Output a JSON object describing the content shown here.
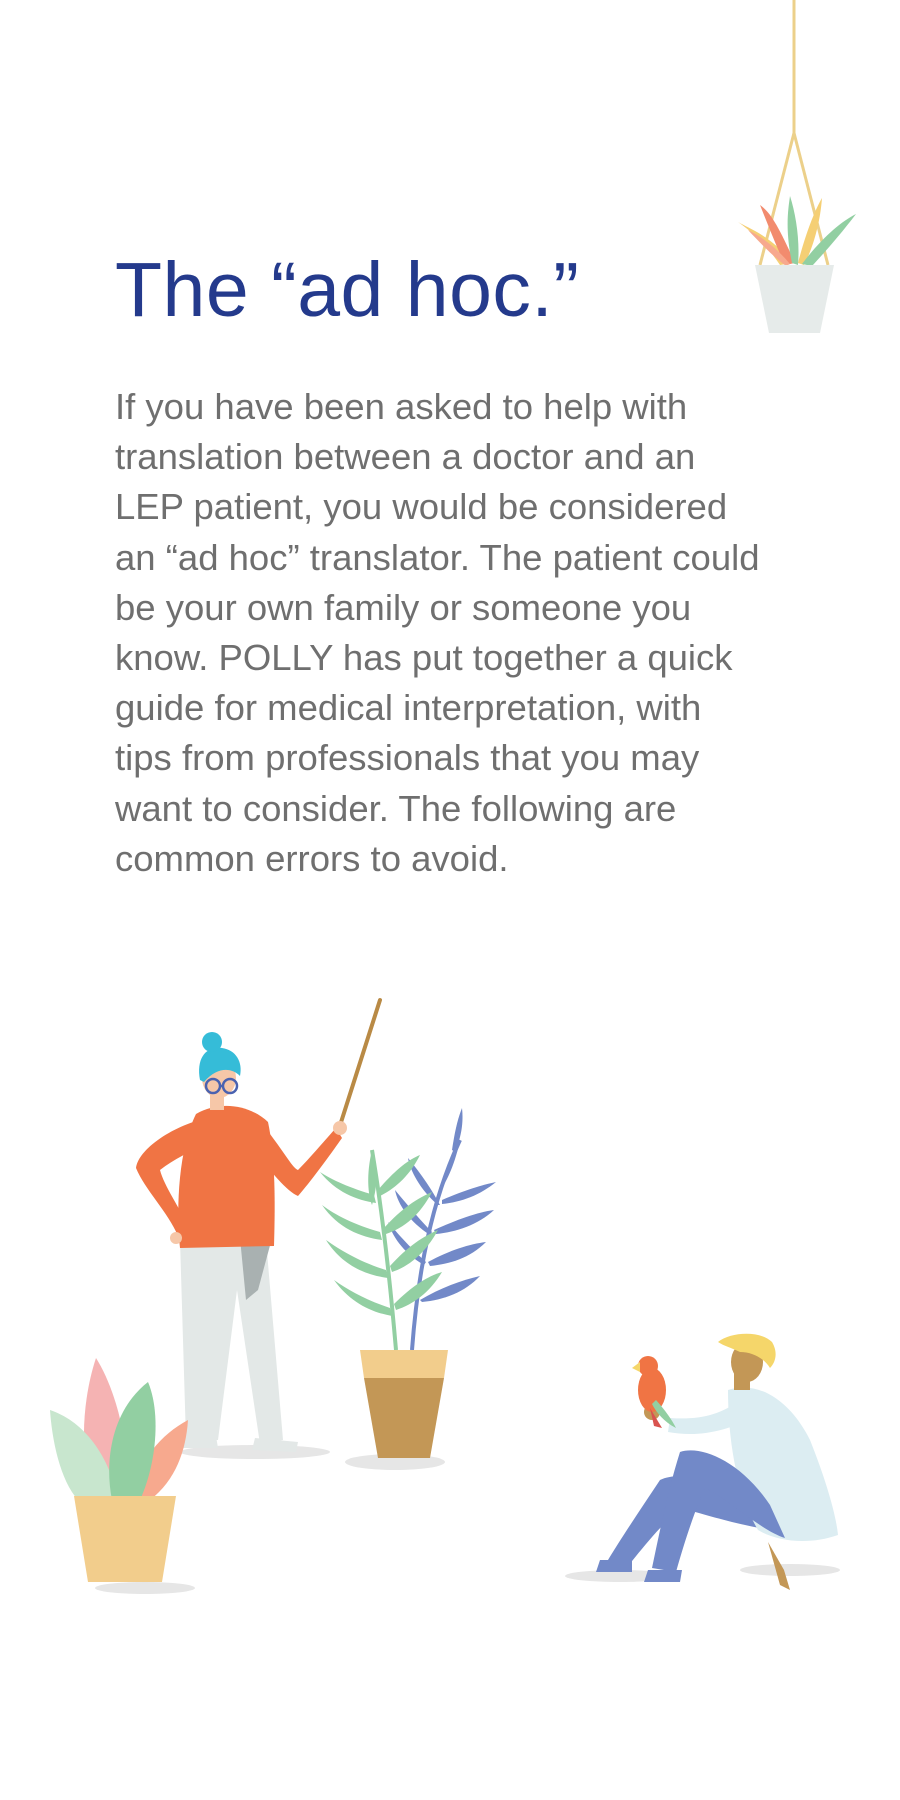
{
  "heading": {
    "title": "The “ad hoc.”"
  },
  "content": {
    "paragraph": "If you have been asked to help with translation between a doctor and an LEP patient, you would be considered an “ad hoc” translator. The patient could be your own family or someone you know. POLLY has put together a quick guide for medical interpretation, with tips from professionals that you may want to consider. The following are common errors to avoid."
  },
  "illustrations": {
    "hanging_plant": "hanging-plant-illustration",
    "teacher": "teacher-with-pointer-illustration",
    "potted_plants": "potted-plants-illustration",
    "seated_man": "seated-man-with-parrot-illustration"
  },
  "colors": {
    "title": "#243a8c",
    "body": "#6f6f6f",
    "orange": "#f07444",
    "teal": "#35bcd8",
    "green": "#92cfa2",
    "blue": "#7289c8",
    "gold": "#c39756"
  }
}
